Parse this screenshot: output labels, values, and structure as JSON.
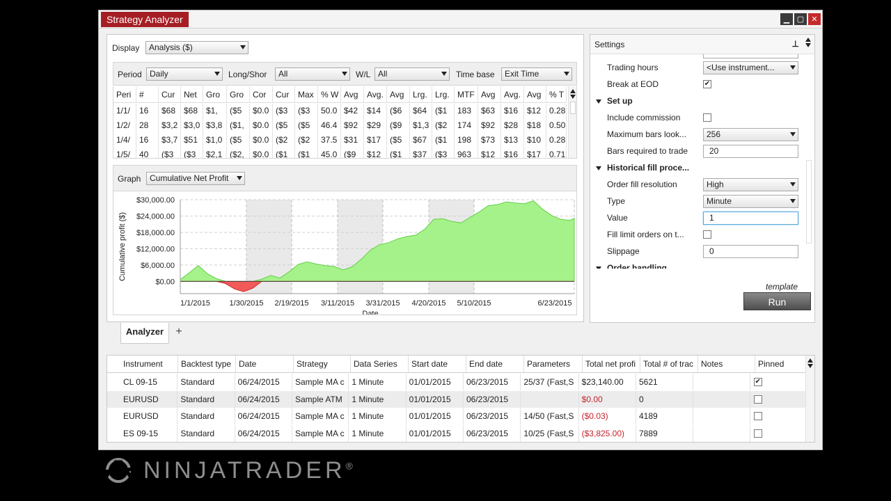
{
  "window": {
    "title": "Strategy Analyzer",
    "controls": [
      "minimize-icon",
      "maximize-icon",
      "close-icon"
    ]
  },
  "display": {
    "label": "Display",
    "value": "Analysis ($)"
  },
  "filters": {
    "period": {
      "label": "Period",
      "value": "Daily"
    },
    "long_short": {
      "label": "Long/Shor",
      "value": "All"
    },
    "wl": {
      "label": "W/L",
      "value": "All"
    },
    "time_base": {
      "label": "Time base",
      "value": "Exit Time"
    }
  },
  "analysis_grid": {
    "columns": [
      "Peri",
      "#",
      "Cur",
      "Net",
      "Gro",
      "Gro",
      "Cor",
      "Cur",
      "Max",
      "% W",
      "Avg",
      "Avg.",
      "Avg",
      "Lrg.",
      "Lrg.",
      "MTF",
      "Avg",
      "Avg.",
      "Avg",
      "% T"
    ],
    "rows": [
      [
        "1/1/",
        "16",
        "$68",
        "$68",
        "$1,",
        "($5",
        "$0.0",
        "($3",
        "($3",
        "50.0",
        "$42",
        "$14",
        "($6",
        "$64",
        "($1",
        "183",
        "$63",
        "$16",
        "$12",
        "0.28"
      ],
      [
        "1/2/",
        "28",
        "$3,2",
        "$3,0",
        "$3,8",
        "($1,",
        "$0.0",
        "($5",
        "($5",
        "46.4",
        "$92",
        "$29",
        "($9",
        "$1,3",
        "($2",
        "174",
        "$92",
        "$28",
        "$18",
        "0.50"
      ],
      [
        "1/4/",
        "16",
        "$3,7",
        "$51",
        "$1,0",
        "($5",
        "$0.0",
        "($2",
        "($2",
        "37.5",
        "$31",
        "$17",
        "($5",
        "$67",
        "($1",
        "198",
        "$73",
        "$13",
        "$10",
        "0.28"
      ],
      [
        "1/5/",
        "40",
        "($3",
        "($3",
        "$2,1",
        "($2,",
        "$0.0",
        "($1",
        "($1",
        "45.0",
        "($9",
        "$12",
        "($1",
        "$37",
        "($3",
        "963",
        "$12",
        "$16",
        "$17",
        "0.71"
      ]
    ]
  },
  "graph": {
    "label": "Graph",
    "value": "Cumulative Net Profit"
  },
  "chart_data": {
    "type": "area",
    "ylabel": "Cumulative profit ($)",
    "xlabel": "Date",
    "y_ticks": [
      "$30,000.00",
      "$24,000.00",
      "$18,000.00",
      "$12,000.00",
      "$6,000.00",
      "$0.00"
    ],
    "ylim": [
      -4500,
      30000
    ],
    "x_ticks": [
      "1/1/2015",
      "1/30/2015",
      "2/19/2015",
      "3/11/2015",
      "3/31/2015",
      "4/20/2015",
      "5/10/2015",
      "6/23/2015"
    ],
    "x": [
      0,
      4,
      8,
      12,
      16,
      20,
      24,
      28,
      32,
      36,
      40,
      44,
      48,
      52,
      56,
      60,
      64,
      68,
      72,
      76,
      80,
      84,
      88,
      92,
      96,
      100,
      104,
      108,
      112,
      116,
      120,
      124,
      128,
      132,
      136,
      140,
      144,
      148,
      152,
      156,
      160,
      164,
      168,
      172,
      174
    ],
    "y": [
      700,
      3200,
      5800,
      2800,
      1000,
      -800,
      -2800,
      -3800,
      -2500,
      800,
      2200,
      1200,
      3500,
      6200,
      7200,
      6400,
      5800,
      5500,
      4200,
      5400,
      8200,
      11500,
      13500,
      14200,
      15600,
      16500,
      17000,
      19200,
      22800,
      23000,
      22000,
      21500,
      23500,
      25500,
      27800,
      28200,
      29200,
      28800,
      28500,
      29600,
      26500,
      24200,
      22800,
      22400,
      23200
    ],
    "grid": true
  },
  "tabs": {
    "analyzer": "Analyzer",
    "add": "+"
  },
  "settings": {
    "title": "Settings",
    "rows": [
      {
        "label": "Trading hours",
        "value": "<Use instrument...",
        "kind": "combo"
      },
      {
        "label": "Break at EOD",
        "value": "✔",
        "kind": "check"
      },
      {
        "label": "Set up",
        "kind": "section"
      },
      {
        "label": "Include commission",
        "value": "",
        "kind": "check"
      },
      {
        "label": "Maximum bars look...",
        "value": "256",
        "kind": "combo"
      },
      {
        "label": "Bars required to trade",
        "value": "20",
        "kind": "text"
      },
      {
        "label": "Historical fill proce...",
        "kind": "section"
      },
      {
        "label": "Order fill resolution",
        "value": "High",
        "kind": "combo"
      },
      {
        "label": "Type",
        "value": "Minute",
        "kind": "combo"
      },
      {
        "label": "Value",
        "value": "1",
        "kind": "text-active"
      },
      {
        "label": "Fill limit orders on t...",
        "value": "",
        "kind": "check"
      },
      {
        "label": "Slippage",
        "value": "0",
        "kind": "text"
      },
      {
        "label": "Order handling",
        "kind": "section-cut"
      }
    ],
    "template_link": "template",
    "run_label": "Run"
  },
  "results": {
    "columns": [
      "Instrument",
      "Backtest type",
      "Date",
      "Strategy",
      "Data Series",
      "Start date",
      "End date",
      "Parameters",
      "Total net profi",
      "Total # of trac",
      "Notes",
      "Pinned"
    ],
    "rows": [
      [
        "CL 09-15",
        "Standard",
        "06/24/2015",
        "Sample MA c",
        "1 Minute",
        "01/01/2015",
        "06/23/2015",
        "25/37 (Fast,S",
        "$23,140.00",
        "5621",
        "",
        "✔"
      ],
      [
        "EURUSD",
        "Standard",
        "06/24/2015",
        "Sample ATM",
        "1 Minute",
        "01/01/2015",
        "06/23/2015",
        "",
        "$0.00",
        "0",
        "",
        ""
      ],
      [
        "EURUSD",
        "Standard",
        "06/24/2015",
        "Sample MA c",
        "1 Minute",
        "01/01/2015",
        "06/23/2015",
        "14/50 (Fast,S",
        "($0.03)",
        "4189",
        "",
        ""
      ],
      [
        "ES 09-15",
        "Standard",
        "06/24/2015",
        "Sample MA c",
        "1 Minute",
        "01/01/2015",
        "06/23/2015",
        "10/25 (Fast,S",
        "($3,825.00)",
        "7889",
        "",
        ""
      ]
    ],
    "negative_color": "#c4222b"
  },
  "brand": {
    "name": "NINJATRADER",
    "mark": "®"
  },
  "colors": {
    "title_tab": "#a51e24",
    "profit_fill": "#a6f28a",
    "loss_fill": "#f25a5a"
  }
}
